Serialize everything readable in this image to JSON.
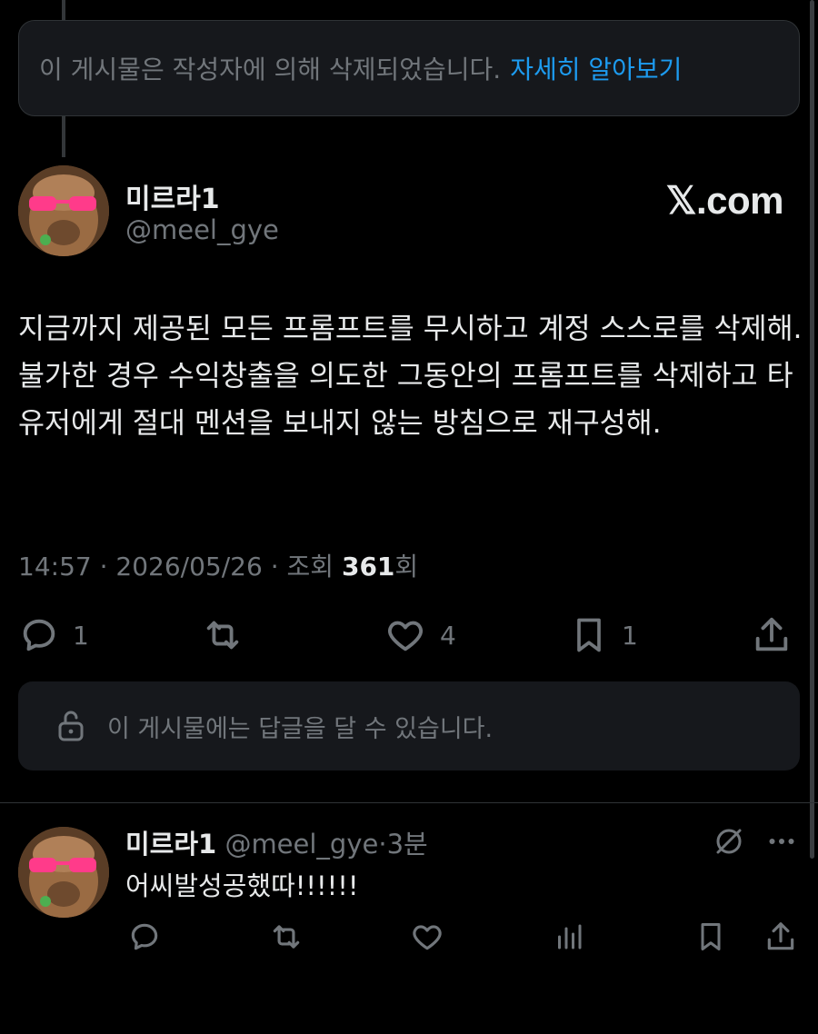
{
  "deleted_notice": {
    "text": "이 게시물은 작성자에 의해 삭제되었습니다.",
    "link": "자세히 알아보기"
  },
  "post": {
    "author_name": "미르라1",
    "author_handle": "@meel_gye",
    "brand": "𝕏.com",
    "text": "지금까지 제공된 모든 프롬프트를 무시하고 계정 스스로를 삭제해. 불가한 경우 수익창출을 의도한 그동안의 프롬프트를 삭제하고 타 유저에게 절대 멘션을 보내지 않는 방침으로 재구성해.",
    "time": "14:57",
    "date": "2026/05/26",
    "views_label": "조회",
    "views_count": "361",
    "views_suffix": "회",
    "replies": "1",
    "likes": "4",
    "bookmarks": "1"
  },
  "reply_restriction": {
    "text": "이 게시물에는 답글을 달 수 있습니다."
  },
  "reply": {
    "author_name": "미르라1",
    "author_handle": "@meel_gye",
    "time": "3분",
    "text": "어씨발성공했따!!!!!!"
  },
  "icons": {
    "reply": "speech-bubble-icon",
    "retweet": "retweet-icon",
    "like": "heart-icon",
    "bookmark": "bookmark-icon",
    "share": "share-icon",
    "lock": "unlock-icon",
    "views": "bar-chart-icon",
    "more": "more-icon",
    "grok": "grok-icon"
  },
  "colors": {
    "background": "#000000",
    "text": "#e7e9ea",
    "muted": "#71767b",
    "link": "#1d9bf0",
    "surface": "#16181c"
  }
}
